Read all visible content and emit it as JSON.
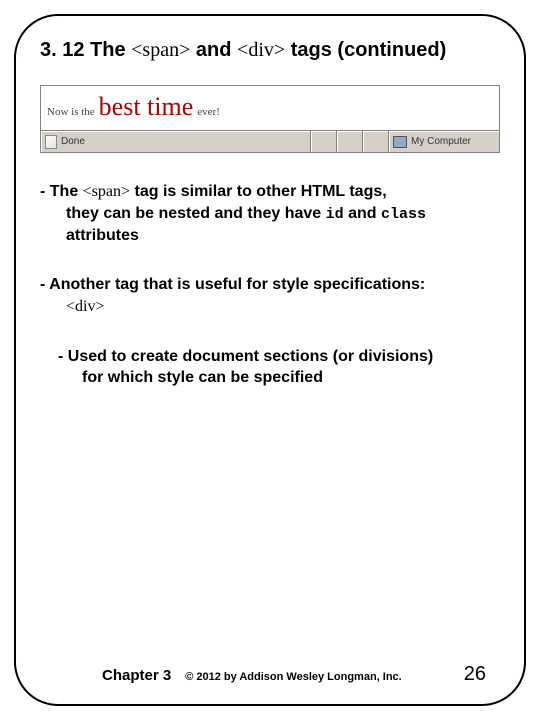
{
  "title": {
    "prefix": "3. 12 The ",
    "tag1": "<span>",
    "mid": " and ",
    "tag2": "<div>",
    "suffix": " tags ",
    "cont": "(continued)"
  },
  "browser": {
    "before": "Now is the ",
    "highlight": "best time",
    "after": " ever!",
    "status_done": "Done",
    "status_location": "My Computer"
  },
  "bullets": {
    "b1": {
      "lead": "- The ",
      "tag": "<span>",
      "rest1": " tag is similar to other HTML tags,",
      "rest2a": "they can be nested and they have ",
      "code_id": "id",
      "rest2b": " and ",
      "code_class": "class",
      "rest3": "attributes"
    },
    "b2": {
      "line": "- Another tag that is useful for style specifications:",
      "tag": "<div>"
    },
    "b3": {
      "line1": "- Used to create document sections (or divisions)",
      "line2": "for which style can be specified"
    }
  },
  "footer": {
    "chapter": "Chapter 3",
    "copyright": "© 2012 by Addison Wesley Longman, Inc.",
    "page": "26"
  }
}
